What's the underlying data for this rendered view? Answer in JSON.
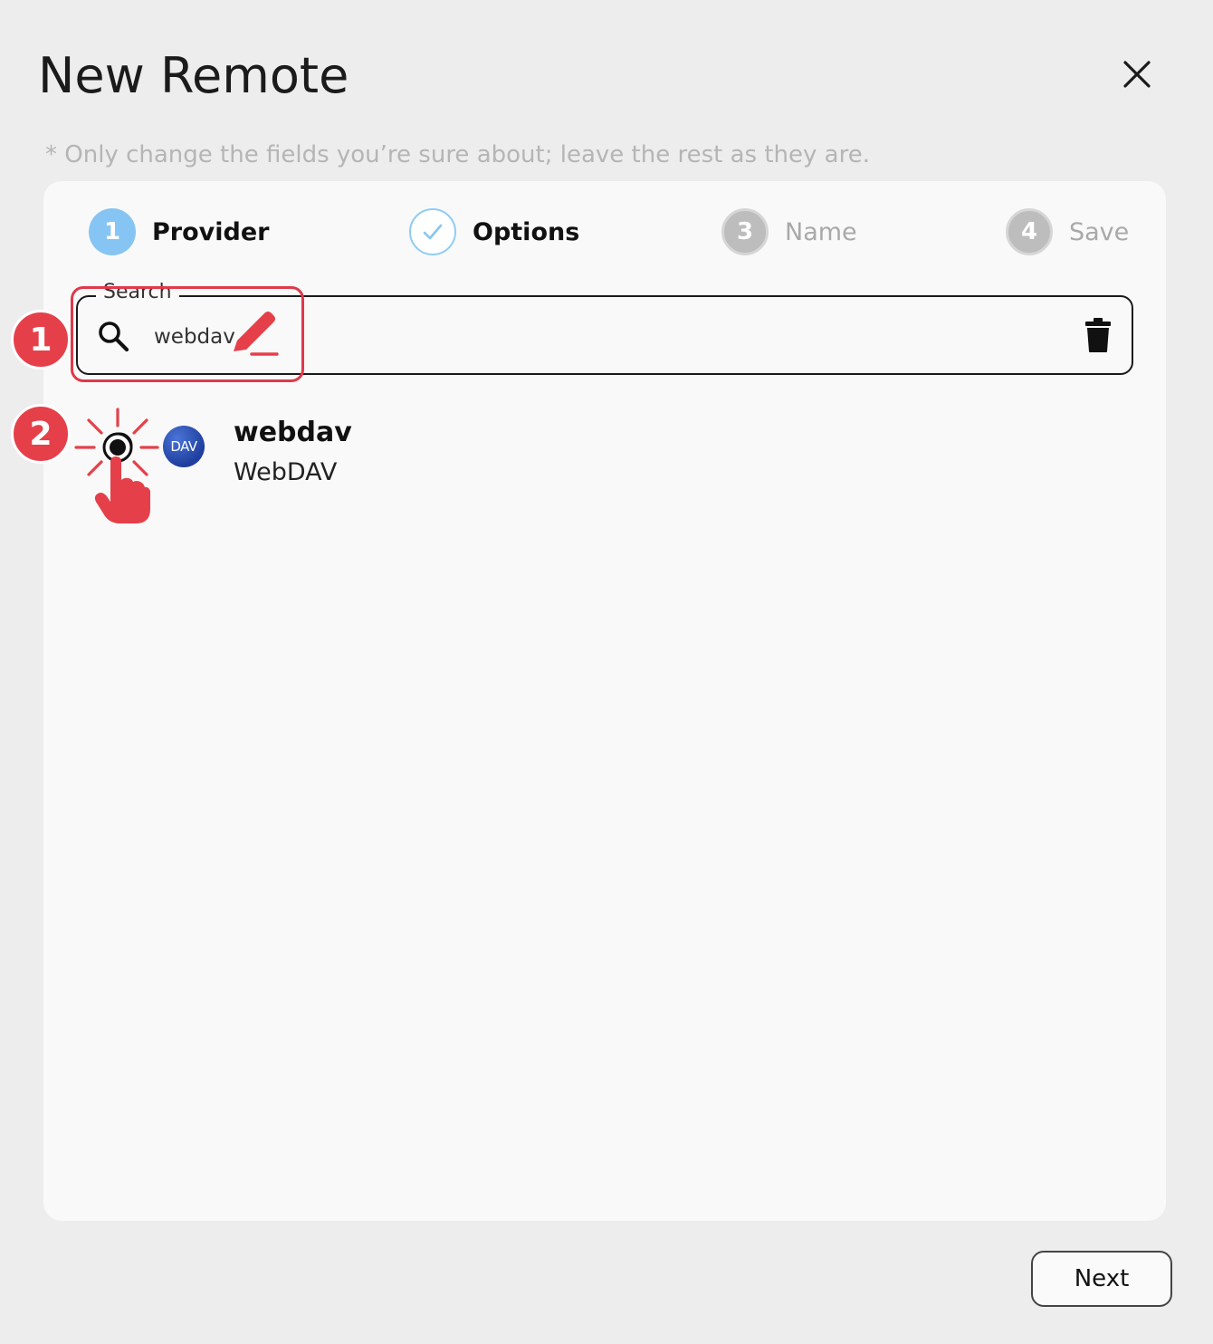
{
  "dialog": {
    "title": "New Remote",
    "hint": "* Only change the fields you’re sure about; leave the rest as they are."
  },
  "stepper": [
    {
      "number": "1",
      "label": "Provider",
      "state": "active"
    },
    {
      "number": "",
      "label": "Options",
      "state": "completed"
    },
    {
      "number": "3",
      "label": "Name",
      "state": "inactive"
    },
    {
      "number": "4",
      "label": "Save",
      "state": "inactive"
    }
  ],
  "search": {
    "legend": "Search",
    "value": "webdav"
  },
  "results": [
    {
      "name": "webdav",
      "description": "WebDAV",
      "logo_text": "DAV",
      "selected": true
    }
  ],
  "annotations": {
    "step_1": "1",
    "step_2": "2",
    "color": "#e5404a"
  },
  "footer": {
    "next_label": "Next"
  }
}
